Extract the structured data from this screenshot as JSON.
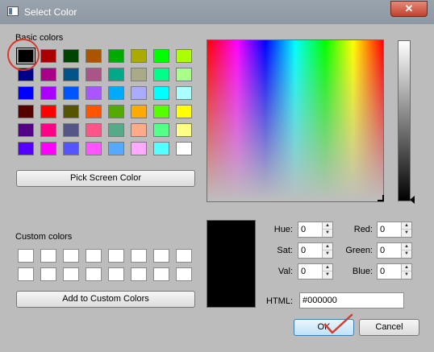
{
  "window": {
    "title": "Select Color",
    "close_label": "✕"
  },
  "basic_colors": {
    "label": "Basic colors",
    "rows": [
      [
        "#000000",
        "#aa0000",
        "#004400",
        "#aa5500",
        "#00aa00",
        "#aaaa00",
        "#00ff00",
        "#aaff00"
      ],
      [
        "#000088",
        "#aa0088",
        "#005588",
        "#aa5588",
        "#00aa88",
        "#aaaa88",
        "#00ff88",
        "#aaff88"
      ],
      [
        "#0000ff",
        "#aa00ff",
        "#0055ff",
        "#aa55ff",
        "#00aaff",
        "#aaaaff",
        "#00ffff",
        "#aaffff"
      ],
      [
        "#550000",
        "#ff0000",
        "#555500",
        "#ff5500",
        "#55aa00",
        "#ffaa00",
        "#55ff00",
        "#ffff00"
      ],
      [
        "#550088",
        "#ff0088",
        "#555588",
        "#ff5588",
        "#55aa88",
        "#ffaa88",
        "#55ff88",
        "#ffff88"
      ],
      [
        "#5500ff",
        "#ff00ff",
        "#5555ff",
        "#ff55ff",
        "#55aaff",
        "#ffaaff",
        "#55ffff",
        "#ffffff"
      ]
    ],
    "selected": "#000000"
  },
  "pick_screen_label": "Pick Screen Color",
  "custom_colors": {
    "label": "Custom colors",
    "count": 16
  },
  "add_custom_label": "Add to Custom Colors",
  "fields": {
    "hue": {
      "label": "Hue:",
      "value": "0"
    },
    "sat": {
      "label": "Sat:",
      "value": "0"
    },
    "val": {
      "label": "Val:",
      "value": "0"
    },
    "red": {
      "label": "Red:",
      "value": "0"
    },
    "green": {
      "label": "Green:",
      "value": "0"
    },
    "blue": {
      "label": "Blue:",
      "value": "0"
    },
    "html": {
      "label": "HTML:",
      "value": "#000000"
    }
  },
  "preview_color": "#000000",
  "buttons": {
    "ok": "OK",
    "cancel": "Cancel"
  },
  "annotation_color": "#d93a2b"
}
